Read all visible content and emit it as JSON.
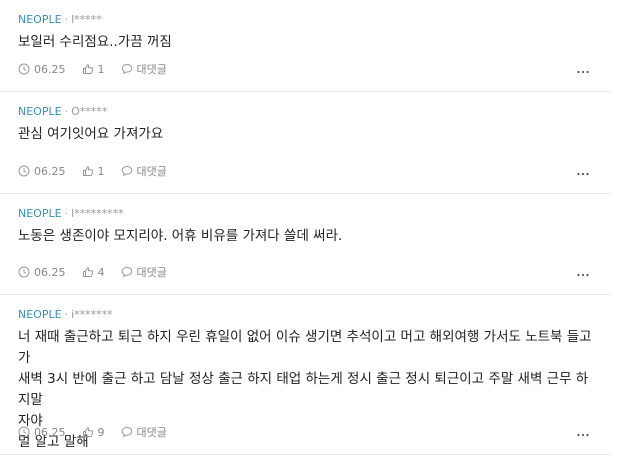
{
  "comments": [
    {
      "author": "NEOPLE",
      "separator": "·",
      "user_id": "l*****",
      "lines": [
        "보일러 수리점요..가끔 꺼짐"
      ],
      "date": "06.25",
      "likes": "1",
      "reply_label": "대댓글"
    },
    {
      "author": "NEOPLE",
      "separator": "·",
      "user_id": "O*****",
      "lines": [
        "관심 여기잇어요 가져가요"
      ],
      "date": "06.25",
      "likes": "1",
      "reply_label": "대댓글"
    },
    {
      "author": "NEOPLE",
      "separator": "·",
      "user_id": "l*********",
      "lines": [
        "노동은 생존이야 모지리야. 어휴 비유를 가져다 쓸데 써라."
      ],
      "date": "06.25",
      "likes": "4",
      "reply_label": "대댓글"
    },
    {
      "author": "NEOPLE",
      "separator": "·",
      "user_id": "i*******",
      "lines": [
        "너 재때 출근하고 퇴근 하지 우린 휴일이 없어 이슈 생기면 추석이고 머고 해외여행 가서도 노트북 들고가",
        "새벽 3시 반에 출근 하고 담날 정상 출근 하지 태업 하는게 정시 출근 정시 퇴근이고 주말 새벽 근무 하지말",
        "자야",
        "멀 알고 말해"
      ],
      "date": "06.25",
      "likes": "9",
      "reply_label": "대댓글"
    }
  ],
  "icons": {
    "clock": "clock-icon",
    "like": "thumbs-up-icon",
    "reply": "speech-bubble-icon",
    "more": "more-dots-icon"
  },
  "colors": {
    "author": "#3a8fb7",
    "meta": "#888888",
    "divider": "#e6e6e6"
  }
}
